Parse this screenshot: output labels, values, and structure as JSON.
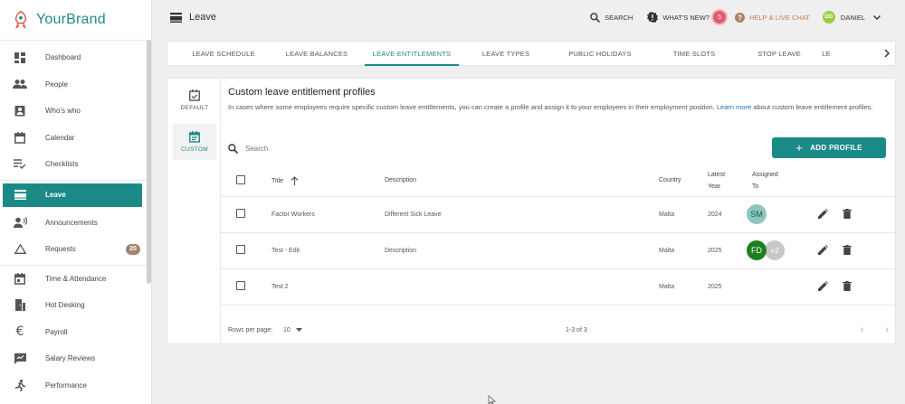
{
  "brand": {
    "name": "YourBrand"
  },
  "sidebar": {
    "items": [
      {
        "label": "Dashboard",
        "icon": "dashboard-icon"
      },
      {
        "label": "People",
        "icon": "people-icon"
      },
      {
        "label": "Who's who",
        "icon": "badge-icon"
      },
      {
        "label": "Calendar",
        "icon": "calendar-icon"
      },
      {
        "label": "Checklists",
        "icon": "checklist-icon"
      },
      {
        "label": "Leave",
        "icon": "leave-icon",
        "active": true
      },
      {
        "label": "Announcements",
        "icon": "announcement-icon"
      },
      {
        "label": "Requests",
        "icon": "warning-triangle-icon",
        "badge": "20"
      },
      {
        "label": "Time & Attendance",
        "icon": "calendar-clock-icon"
      },
      {
        "label": "Hot Desking",
        "icon": "desk-icon"
      },
      {
        "label": "Payroll",
        "icon": "euro-icon"
      },
      {
        "label": "Salary Reviews",
        "icon": "review-icon"
      },
      {
        "label": "Performance",
        "icon": "running-icon"
      }
    ]
  },
  "header": {
    "title": "Leave",
    "search_label": "SEARCH",
    "whats_new_label": "WHAT'S NEW?",
    "whats_new_count": "5",
    "help_label": "HELP & LIVE CHAT",
    "user_initials": "DG",
    "user_name": "DANIEL"
  },
  "tabs": [
    "LEAVE SCHEDULE",
    "LEAVE BALANCES",
    "LEAVE ENTITLEMENTS",
    "LEAVE TYPES",
    "PUBLIC HOLIDAYS",
    "TIME SLOTS",
    "STOP LEAVE",
    "LE"
  ],
  "active_tab": 2,
  "side_tabs": {
    "default": "DEFAULT",
    "custom": "CUSTOM"
  },
  "section": {
    "title": "Custom leave entitlement profiles",
    "description": "In cases where some employees require specific custom leave entitlements, you can create a profile and assign it to your employees in their employment position.",
    "link": "Learn more",
    "description_tail": "about custom leave entitlement profiles."
  },
  "search": {
    "placeholder": "Search"
  },
  "add_button": "ADD PROFILE",
  "table": {
    "headers": {
      "title": "Title",
      "description": "Description",
      "country": "Country",
      "latest_year_1": "Latest",
      "latest_year_2": "Year",
      "assigned_1": "Assigned",
      "assigned_2": "To"
    },
    "rows": [
      {
        "title": "Factor Workers",
        "description": "Different Sick Leave",
        "country": "Malta",
        "year": "2024",
        "assigned": [
          "SM"
        ],
        "extra": ""
      },
      {
        "title": "Test - Edit",
        "description": "Description",
        "country": "Malta",
        "year": "2025",
        "assigned": [
          "FD"
        ],
        "extra": "+2"
      },
      {
        "title": "Test 2",
        "description": "",
        "country": "Malta",
        "year": "2025",
        "assigned": [],
        "extra": ""
      }
    ]
  },
  "footer": {
    "rows_per_page_label": "Rows per page:",
    "rows_per_page": "10",
    "range": "1-3 of 3"
  },
  "colors": {
    "accent": "#1b8a86",
    "avatar_sm": "#8cc6bd",
    "avatar_fd": "#1c7f1c",
    "avatar_extra": "#c7c7c7"
  }
}
